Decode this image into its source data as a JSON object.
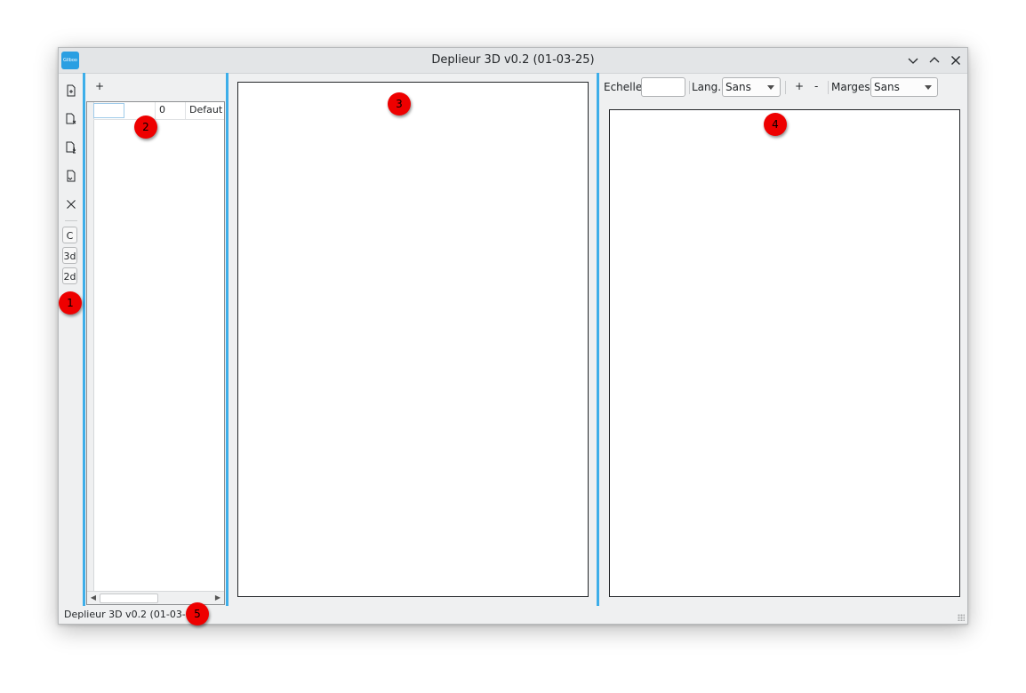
{
  "window": {
    "title": "Deplieur 3D v0.2 (01-03-25)",
    "app_icon_text": "Gilboo"
  },
  "toolbar_left": {
    "icons": [
      "new-file-icon",
      "close-file-icon",
      "save-file-icon",
      "export-file-icon",
      "close-icon"
    ],
    "buttons": [
      {
        "label": "C"
      },
      {
        "label": "3d"
      },
      {
        "label": "2d"
      }
    ]
  },
  "panel2": {
    "add_label": "+",
    "rows": [
      {
        "name": "",
        "count": "0",
        "style": "Defaut"
      }
    ]
  },
  "right_toolbar": {
    "scale_label": "Echelle:",
    "scale_value": "",
    "lang_label": "Lang.:",
    "lang_value": "Sans",
    "plus_label": "+",
    "minus_label": "-",
    "margins_label": "Marges:",
    "margins_value": "Sans"
  },
  "status_bar": {
    "text": "Deplieur 3D v0.2 (01-03-25)"
  },
  "markers": [
    "1",
    "2",
    "3",
    "4",
    "5"
  ],
  "colors": {
    "accent": "#3daee9",
    "marker": "#ee0000",
    "window_bg": "#eff0f1"
  }
}
